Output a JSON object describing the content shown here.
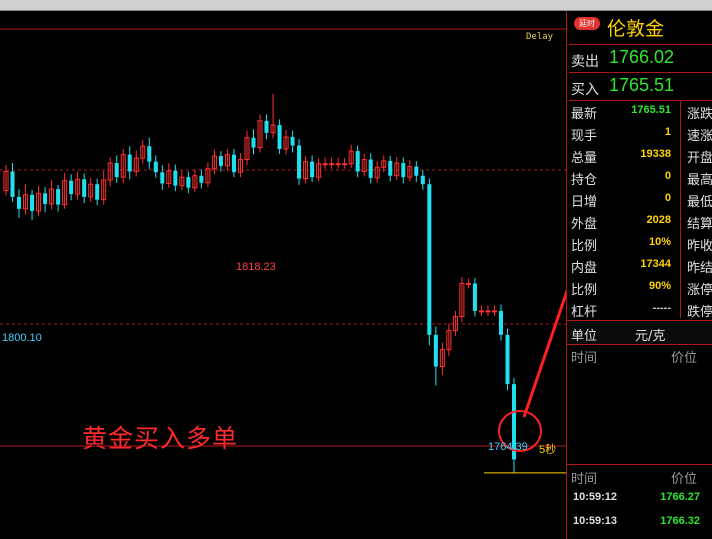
{
  "chart": {
    "delay_label": "Delay",
    "high_label": "1818.23",
    "low_label": "1800.10",
    "current_label": "1764.39",
    "timeframe_label": "5秒",
    "annotation": "黄金买入多单",
    "colors": {
      "up": "#ff3030",
      "down": "#20e0f0",
      "grid": "#b01818",
      "arrow": "#ff2020"
    }
  },
  "panel": {
    "badge": "延时",
    "title": "伦敦金",
    "sell": {
      "label": "卖出",
      "value": "1766.02"
    },
    "buy": {
      "label": "买入",
      "value": "1765.51"
    },
    "stats": [
      {
        "label": "最新",
        "value": "1765.51",
        "color": "#2ee62e",
        "right": "涨跌"
      },
      {
        "label": "现手",
        "value": "1",
        "color": "#ffd200",
        "right": "速涨"
      },
      {
        "label": "总量",
        "value": "19338",
        "color": "#ffd200",
        "right": "开盘"
      },
      {
        "label": "持仓",
        "value": "0",
        "color": "#ffd200",
        "right": "最高"
      },
      {
        "label": "日增",
        "value": "0",
        "color": "#ffd200",
        "right": "最低"
      },
      {
        "label": "外盘",
        "value": "2028",
        "color": "#ffd200",
        "right": "结算"
      },
      {
        "label": "比例",
        "value": "10%",
        "color": "#ffd200",
        "right": "昨收"
      },
      {
        "label": "内盘",
        "value": "17344",
        "color": "#ffd200",
        "right": "昨结"
      },
      {
        "label": "比例",
        "value": "90%",
        "color": "#ffd200",
        "right": "涨停"
      },
      {
        "label": "杠杆",
        "value": "-----",
        "color": "#cfcfcf",
        "right": "跌停"
      }
    ],
    "unit": {
      "label": "单位",
      "value": "元/克"
    },
    "ticks_header": {
      "time": "时间",
      "price": "价位"
    },
    "ticks": [
      {
        "time": "10:59:12",
        "price": "1766.27"
      },
      {
        "time": "10:59:13",
        "price": "1766.32"
      }
    ]
  },
  "chart_data": {
    "type": "candlestick",
    "title": "",
    "ylim": [
      1755,
      1830
    ],
    "markers": {
      "high": 1818.23,
      "low": 1800.1,
      "last": 1764.39
    },
    "candles": [
      [
        1804.5,
        1807.2,
        1803.8,
        1808.1
      ],
      [
        1807.2,
        1803.6,
        1802.9,
        1808.4
      ],
      [
        1803.6,
        1801.9,
        1800.6,
        1804.7
      ],
      [
        1801.9,
        1803.9,
        1801.1,
        1805.4
      ],
      [
        1803.9,
        1801.6,
        1800.3,
        1804.6
      ],
      [
        1801.6,
        1804.1,
        1800.9,
        1805.2
      ],
      [
        1804.1,
        1802.6,
        1801.4,
        1805.0
      ],
      [
        1802.6,
        1804.7,
        1801.8,
        1806.0
      ],
      [
        1804.7,
        1802.5,
        1801.5,
        1805.3
      ],
      [
        1802.5,
        1805.9,
        1801.9,
        1807.0
      ],
      [
        1805.9,
        1804.0,
        1803.1,
        1806.8
      ],
      [
        1804.0,
        1806.1,
        1803.2,
        1807.2
      ],
      [
        1806.1,
        1803.6,
        1802.7,
        1806.9
      ],
      [
        1803.6,
        1805.4,
        1802.9,
        1806.3
      ],
      [
        1805.4,
        1803.2,
        1802.4,
        1806.2
      ],
      [
        1803.2,
        1806.0,
        1802.5,
        1807.3
      ],
      [
        1806.0,
        1808.4,
        1805.1,
        1809.2
      ],
      [
        1808.4,
        1806.4,
        1805.6,
        1809.5
      ],
      [
        1806.4,
        1809.6,
        1805.5,
        1810.4
      ],
      [
        1809.6,
        1807.2,
        1806.1,
        1810.8
      ],
      [
        1807.2,
        1809.1,
        1806.5,
        1810.2
      ],
      [
        1809.1,
        1810.8,
        1808.3,
        1811.7
      ],
      [
        1810.8,
        1808.6,
        1807.5,
        1812.0
      ],
      [
        1808.6,
        1807.1,
        1806.3,
        1809.5
      ],
      [
        1807.1,
        1805.5,
        1804.6,
        1808.1
      ],
      [
        1805.5,
        1807.3,
        1804.9,
        1808.4
      ],
      [
        1807.3,
        1805.2,
        1804.4,
        1808.2
      ],
      [
        1805.2,
        1806.4,
        1804.5,
        1807.3
      ],
      [
        1806.4,
        1804.9,
        1804.1,
        1807.2
      ],
      [
        1804.9,
        1806.6,
        1804.3,
        1807.5
      ],
      [
        1806.6,
        1805.6,
        1804.8,
        1807.5
      ],
      [
        1805.6,
        1807.6,
        1805.0,
        1808.5
      ],
      [
        1807.6,
        1809.4,
        1806.8,
        1810.3
      ],
      [
        1809.4,
        1808.0,
        1807.2,
        1810.1
      ],
      [
        1808.0,
        1809.6,
        1807.3,
        1810.4
      ],
      [
        1809.6,
        1807.1,
        1806.4,
        1810.4
      ],
      [
        1807.1,
        1808.9,
        1806.4,
        1809.8
      ],
      [
        1808.9,
        1812.0,
        1808.1,
        1813.0
      ],
      [
        1812.0,
        1810.6,
        1809.6,
        1813.2
      ],
      [
        1810.6,
        1814.4,
        1809.9,
        1815.3
      ],
      [
        1814.4,
        1812.7,
        1811.8,
        1815.3
      ],
      [
        1812.7,
        1813.8,
        1811.9,
        1818.23
      ],
      [
        1813.8,
        1810.4,
        1809.7,
        1814.6
      ],
      [
        1810.4,
        1812.1,
        1809.6,
        1813.1
      ],
      [
        1812.1,
        1810.9,
        1809.9,
        1813.0
      ],
      [
        1810.9,
        1806.2,
        1805.3,
        1811.8
      ],
      [
        1806.2,
        1808.6,
        1805.5,
        1809.4
      ],
      [
        1808.6,
        1806.4,
        1805.7,
        1809.5
      ],
      [
        1806.4,
        1808.3,
        1805.8,
        1809.1
      ],
      [
        1808.3,
        1808.3,
        1807.6,
        1809.2
      ],
      [
        1808.3,
        1808.3,
        1807.6,
        1809.2
      ],
      [
        1808.3,
        1808.3,
        1807.6,
        1809.2
      ],
      [
        1808.3,
        1808.3,
        1807.6,
        1809.1
      ],
      [
        1808.3,
        1810.1,
        1807.7,
        1811.0
      ],
      [
        1810.1,
        1807.2,
        1806.4,
        1810.9
      ],
      [
        1807.2,
        1808.9,
        1806.5,
        1809.7
      ],
      [
        1808.9,
        1806.3,
        1805.5,
        1809.8
      ],
      [
        1806.3,
        1807.8,
        1805.6,
        1808.7
      ],
      [
        1807.8,
        1808.7,
        1807.1,
        1809.5
      ],
      [
        1808.7,
        1806.6,
        1805.8,
        1809.4
      ],
      [
        1806.6,
        1808.4,
        1806.0,
        1809.3
      ],
      [
        1808.4,
        1806.4,
        1805.5,
        1809.2
      ],
      [
        1806.4,
        1807.9,
        1805.8,
        1808.8
      ],
      [
        1807.9,
        1806.6,
        1805.7,
        1808.7
      ],
      [
        1806.6,
        1805.4,
        1804.6,
        1807.4
      ],
      [
        1805.4,
        1784.0,
        1782.5,
        1806.2
      ],
      [
        1784.0,
        1779.5,
        1776.8,
        1785.2
      ],
      [
        1779.5,
        1781.9,
        1778.3,
        1782.9
      ],
      [
        1781.9,
        1784.6,
        1781.0,
        1785.6
      ],
      [
        1784.6,
        1786.6,
        1783.8,
        1787.4
      ],
      [
        1786.6,
        1791.3,
        1785.8,
        1792.2
      ],
      [
        1791.3,
        1791.3,
        1790.6,
        1792.0
      ],
      [
        1791.3,
        1787.4,
        1786.6,
        1792.1
      ],
      [
        1787.4,
        1787.4,
        1786.7,
        1788.2
      ],
      [
        1787.4,
        1787.4,
        1786.7,
        1788.2
      ],
      [
        1787.4,
        1787.4,
        1786.7,
        1788.2
      ],
      [
        1787.4,
        1784.0,
        1783.2,
        1788.3
      ],
      [
        1784.0,
        1777.0,
        1776.1,
        1784.9
      ],
      [
        1777.0,
        1766.3,
        1764.39,
        1777.9
      ]
    ]
  }
}
